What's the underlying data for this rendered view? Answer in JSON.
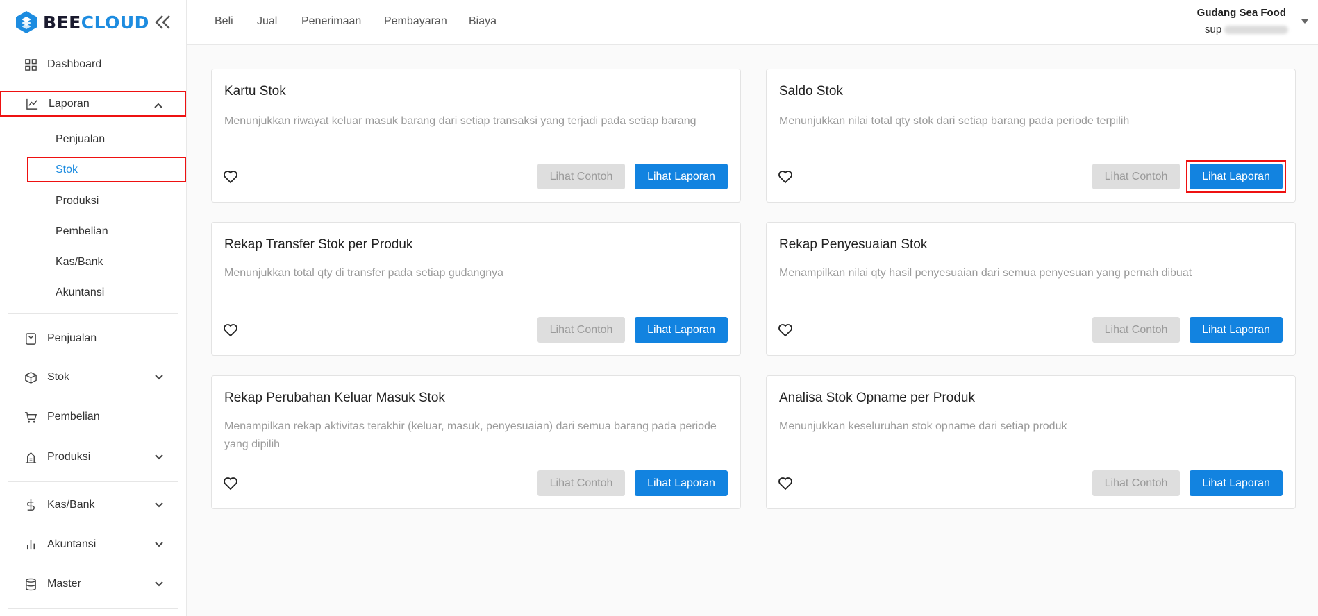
{
  "brand": {
    "name_part1": "BEE",
    "name_part2": "CLOUD",
    "accent": "#1d8ce0"
  },
  "sidebar": {
    "items": [
      {
        "label": "Dashboard",
        "icon": "grid-icon"
      },
      {
        "label": "Laporan",
        "icon": "line-chart-icon",
        "expanded": true
      },
      {
        "label": "Penjualan",
        "icon": "receipt-icon"
      },
      {
        "label": "Stok",
        "icon": "box-icon"
      },
      {
        "label": "Pembelian",
        "icon": "cart-icon"
      },
      {
        "label": "Produksi",
        "icon": "factory-icon"
      },
      {
        "label": "Kas/Bank",
        "icon": "dollar-icon"
      },
      {
        "label": "Akuntansi",
        "icon": "bar-chart-icon"
      },
      {
        "label": "Master",
        "icon": "database-icon"
      }
    ],
    "laporan_sub": [
      "Penjualan",
      "Stok",
      "Produksi",
      "Pembelian",
      "Kas/Bank",
      "Akuntansi"
    ],
    "active_sub": "Stok"
  },
  "topnav": [
    "Beli",
    "Jual",
    "Penerimaan",
    "Pembayaran",
    "Biaya"
  ],
  "user": {
    "company": "Gudang Sea Food",
    "email_prefix": "sup"
  },
  "buttons": {
    "contoh": "Lihat Contoh",
    "laporan": "Lihat Laporan"
  },
  "cards": [
    {
      "title": "Kartu Stok",
      "desc": "Menunjukkan riwayat keluar masuk barang dari setiap transaksi yang terjadi pada setiap barang"
    },
    {
      "title": "Saldo Stok",
      "desc": "Menunjukkan nilai total qty stok dari setiap barang pada periode terpilih"
    },
    {
      "title": "Rekap Transfer Stok per Produk",
      "desc": "Menunjukkan total qty di transfer pada setiap gudangnya"
    },
    {
      "title": "Rekap Penyesuaian Stok",
      "desc": "Menampilkan nilai qty hasil penyesuaian dari semua penyesuan yang pernah dibuat"
    },
    {
      "title": "Rekap Perubahan Keluar Masuk Stok",
      "desc": "Menampilkan rekap aktivitas terakhir (keluar, masuk, penyesuaian) dari semua barang pada periode yang dipilih"
    },
    {
      "title": "Analisa Stok Opname per Produk",
      "desc": "Menunjukkan keseluruhan stok opname dari setiap produk"
    }
  ],
  "colors": {
    "primary_button": "#1283e0",
    "highlight_border": "#e11111",
    "disabled_button": "#dedede"
  }
}
